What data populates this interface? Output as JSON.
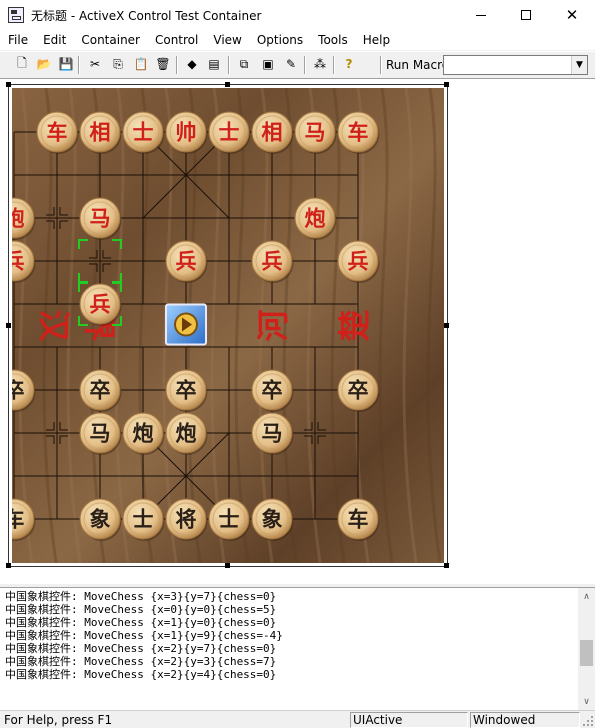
{
  "window": {
    "title": "无标题 - ActiveX Control Test Container",
    "min_symbol": "─",
    "max_symbol": "☐",
    "close_symbol": "✕"
  },
  "menu": [
    "File",
    "Edit",
    "Container",
    "Control",
    "View",
    "Options",
    "Tools",
    "Help"
  ],
  "toolbar": {
    "buttons": [
      "new-icon",
      "open-icon",
      "save-icon",
      "cut-icon",
      "copy-icon",
      "paste-icon",
      "delete-icon",
      "insert-control-icon",
      "properties-icon",
      "invoke-methods-icon",
      "draw-metafile-icon",
      "macros-icon",
      "events-icon",
      "help-icon"
    ],
    "run_macro_label": "Run Macro:",
    "run_macro_value": ""
  },
  "board": {
    "river_left": "汉界",
    "river_right": "河楚",
    "red_pieces": [
      {
        "char": "车",
        "col": 0,
        "row": 0
      },
      {
        "char": "相",
        "col": 1,
        "row": 0
      },
      {
        "char": "士",
        "col": 2,
        "row": 0
      },
      {
        "char": "帅",
        "col": 3,
        "row": 0
      },
      {
        "char": "士",
        "col": 4,
        "row": 0
      },
      {
        "char": "相",
        "col": 5,
        "row": 0
      },
      {
        "char": "马",
        "col": 6,
        "row": 0
      },
      {
        "char": "车",
        "col": 7,
        "row": 0
      },
      {
        "char": "炮",
        "col": -1,
        "row": 2
      },
      {
        "char": "马",
        "col": 1,
        "row": 2
      },
      {
        "char": "炮",
        "col": 6,
        "row": 2
      },
      {
        "char": "兵",
        "col": -1,
        "row": 3
      },
      {
        "char": "兵",
        "col": 3,
        "row": 3
      },
      {
        "char": "兵",
        "col": 5,
        "row": 3
      },
      {
        "char": "兵",
        "col": 7,
        "row": 3
      },
      {
        "char": "兵",
        "col": 1,
        "row": 4
      }
    ],
    "black_pieces": [
      {
        "char": "卒",
        "col": -1,
        "row": 6
      },
      {
        "char": "卒",
        "col": 1,
        "row": 6
      },
      {
        "char": "卒",
        "col": 3,
        "row": 6
      },
      {
        "char": "卒",
        "col": 5,
        "row": 6
      },
      {
        "char": "卒",
        "col": 7,
        "row": 6
      },
      {
        "char": "马",
        "col": 1,
        "row": 7
      },
      {
        "char": "炮",
        "col": 2,
        "row": 7
      },
      {
        "char": "炮",
        "col": 3,
        "row": 7
      },
      {
        "char": "马",
        "col": 5,
        "row": 7
      },
      {
        "char": "车",
        "col": -1,
        "row": 9
      },
      {
        "char": "象",
        "col": 1,
        "row": 9
      },
      {
        "char": "士",
        "col": 2,
        "row": 9
      },
      {
        "char": "将",
        "col": 3,
        "row": 9
      },
      {
        "char": "士",
        "col": 4,
        "row": 9
      },
      {
        "char": "象",
        "col": 5,
        "row": 9
      },
      {
        "char": "车",
        "col": 7,
        "row": 9
      }
    ],
    "red_color": "#d0201a",
    "black_color": "#2a2018",
    "selection_color": "#22cc22"
  },
  "log": [
    "中国象棋控件: MoveChess {x=3}{y=7}{chess=0}",
    "中国象棋控件: MoveChess {x=0}{y=0}{chess=5}",
    "中国象棋控件: MoveChess {x=1}{y=0}{chess=0}",
    "中国象棋控件: MoveChess {x=1}{y=9}{chess=-4}",
    "中国象棋控件: MoveChess {x=2}{y=7}{chess=0}",
    "中国象棋控件: MoveChess {x=2}{y=3}{chess=7}",
    "中国象棋控件: MoveChess {x=2}{y=4}{chess=0}"
  ],
  "status": {
    "help": "For Help, press F1",
    "ui": "UIActive",
    "mode": "Windowed"
  }
}
